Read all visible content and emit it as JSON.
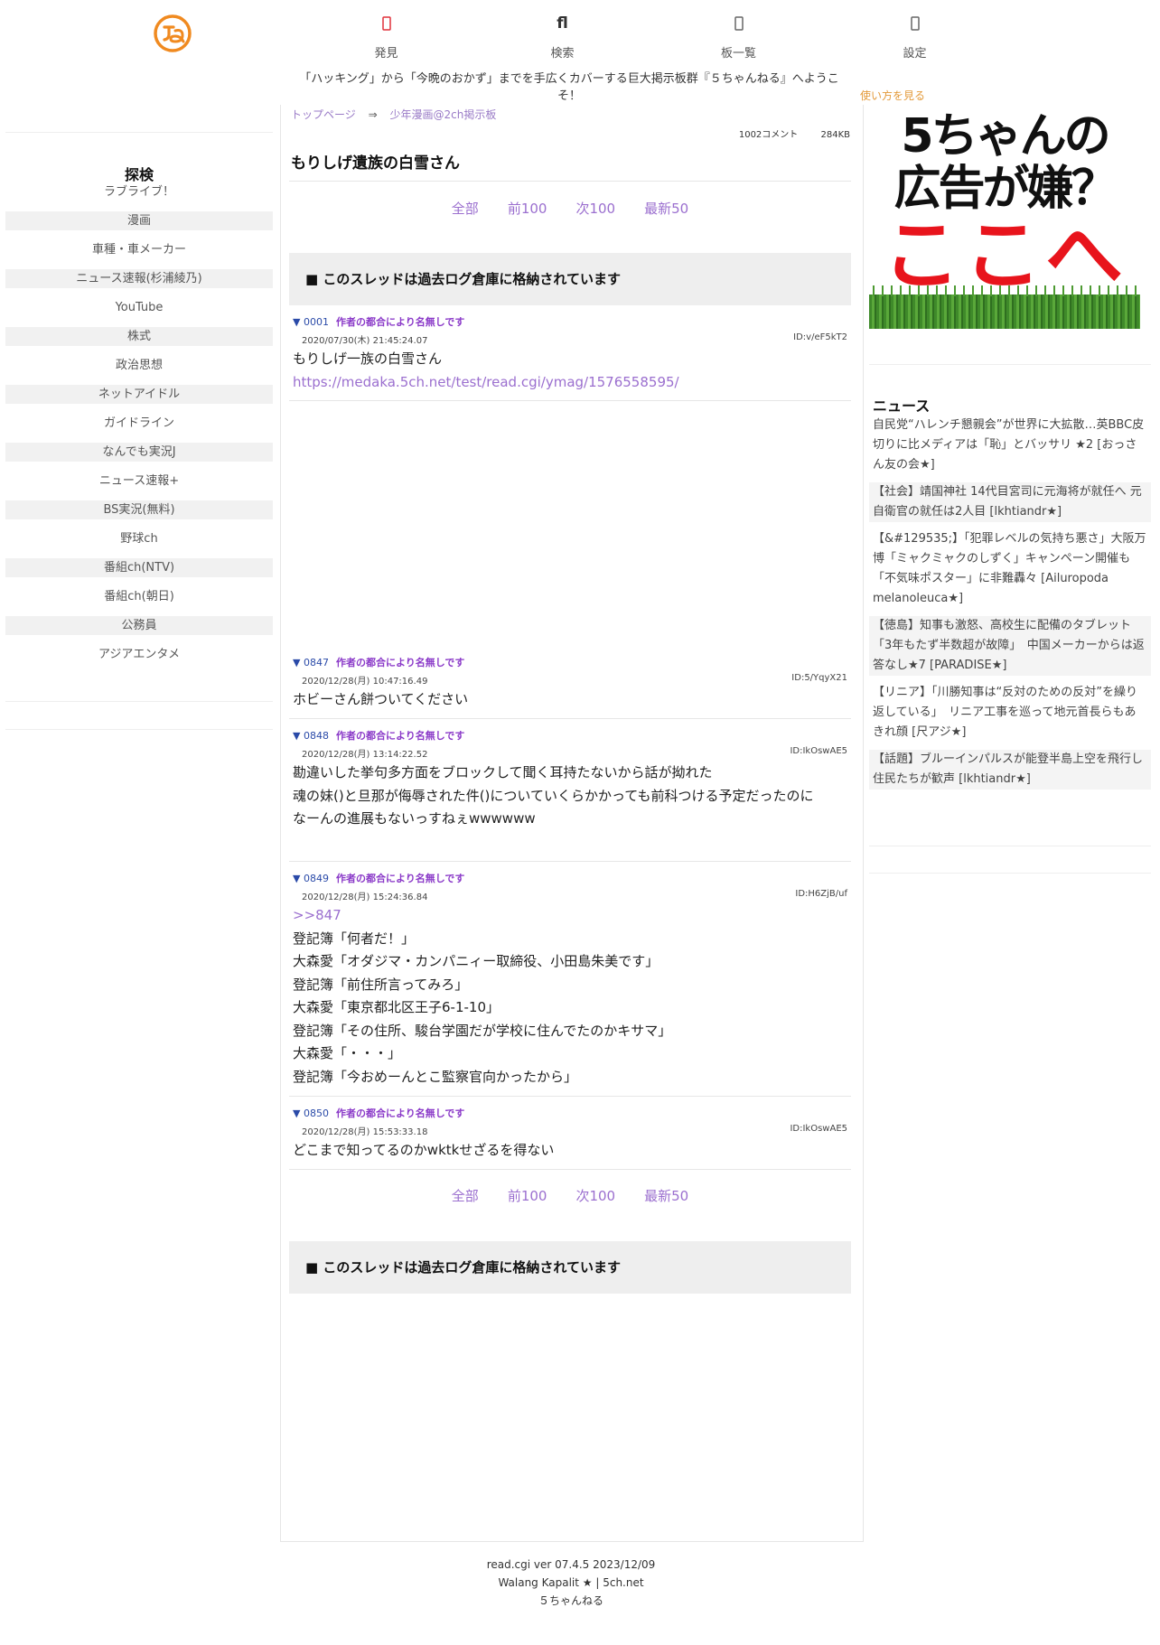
{
  "header": {
    "nav": [
      {
        "label": "発見",
        "icon": "discover-icon"
      },
      {
        "label": "検索",
        "icon": "search-icon"
      },
      {
        "label": "板一覧",
        "icon": "board-list-icon"
      },
      {
        "label": "設定",
        "icon": "settings-icon"
      }
    ],
    "tagline": "「ハッキング」から「今晩のおかず」までを手広くカバーする巨大掲示板群『５ちゃんねる』へようこそ！"
  },
  "sidebar": {
    "title": "探検",
    "items": [
      "ラブライブ！",
      "漫画",
      "車種・車メーカー",
      "ニュース速報(杉浦綾乃)",
      "YouTube",
      "株式",
      "政治思想",
      "ネットアイドル",
      "ガイドライン",
      "なんでも実況J",
      "ニュース速報+",
      "BS実況(無料)",
      "野球ch",
      "番組ch(NTV)",
      "番組ch(朝日)",
      "公務員",
      "アジアエンタメ"
    ]
  },
  "thread": {
    "breadcrumb_top": "トップページ",
    "breadcrumb_arrow": "⇒",
    "breadcrumb_board": "少年漫画@2ch掲示板",
    "comments": "1002コメント",
    "size": "284KB",
    "title": "もりしげ遺族の白雪さん",
    "pager": [
      "全部",
      "前100",
      "次100",
      "最新50"
    ],
    "archived": "■ このスレッドは過去ログ倉庫に格納されています"
  },
  "posts": [
    {
      "num": "0001",
      "name": "作者の都合により名無しです",
      "date": "2020/07/30(木) 21:45:24.07",
      "id": "ID:v/eF5kT2",
      "anchor": "",
      "lines": [
        "もりしげ一族の白雪さん"
      ],
      "link": "https://medaka.5ch.net/test/read.cgi/ymag/1576558595/"
    },
    {
      "num": "0847",
      "name": "作者の都合により名無しです",
      "date": "2020/12/28(月) 10:47:16.49",
      "id": "ID:5/YqyX21",
      "anchor": "",
      "lines": [
        "ホビーさん餅ついてください"
      ],
      "link": ""
    },
    {
      "num": "0848",
      "name": "作者の都合により名無しです",
      "date": "2020/12/28(月) 13:14:22.52",
      "id": "ID:IkOswAE5",
      "anchor": "",
      "lines": [
        "勘違いした挙句多方面をブロックして聞く耳持たないから話が拗れた",
        "魂の妹()と旦那が侮辱された件()についていくらかかっても前科つける予定だったのに",
        "なーんの進展もないっすねぇwwwwww"
      ],
      "link": ""
    },
    {
      "num": "0849",
      "name": "作者の都合により名無しです",
      "date": "2020/12/28(月) 15:24:36.84",
      "id": "ID:H6ZjB/uf",
      "anchor": ">>847",
      "lines": [
        "登記簿「何者だ！」",
        "大森愛「オダジマ・カンパニィー取締役、小田島朱美です」",
        "登記簿「前住所言ってみろ」",
        "大森愛「東京都北区王子6-1-10」",
        "登記簿「その住所、駿台学園だが学校に住んでたのかキサマ」",
        "大森愛「・・・」",
        "登記簿「今おめーんとこ監察官向かったから」"
      ],
      "link": ""
    },
    {
      "num": "0850",
      "name": "作者の都合により名無しです",
      "date": "2020/12/28(月) 15:53:33.18",
      "id": "ID:IkOswAE5",
      "anchor": "",
      "lines": [
        "どこまで知ってるのかwktkせざるを得ない"
      ],
      "link": ""
    }
  ],
  "right": {
    "howto": "使い方を見る",
    "ad": {
      "line1": "5ちゃんの",
      "line2": "広告が嫌？",
      "line3": "ここへ"
    },
    "news_title": "ニュース",
    "news": [
      "自民党“ハレンチ懇親会”が世界に大拡散…英BBC皮切りに比メディアは「恥」とバッサリ ★2 [おっさん友の会★]",
      "【社会】靖国神社 14代目宮司に元海将が就任へ 元自衛官の就任は2人目 [lkhtiandr★]",
      "【&#129535;】「犯罪レベルの気持ち悪さ」大阪万博「ミャクミャクのしずく」キャンペーン開催も「不気味ポスター」に非難轟々 [Ailuropoda melanoleuca★]",
      "【徳島】知事も激怒、高校生に配備のタブレット「3年もたず半数超が故障」　中国メーカーからは返答なし★7 [PARADISE★]",
      "【リニア】「川勝知事は“反対のための反対”を繰り返している」　リニア工事を巡って地元首長らもあきれ顔 [尺アジ★]",
      "【話題】ブルーインパルスが能登半島上空を飛行し 住民たちが歓声 [lkhtiandr★]"
    ]
  },
  "footer": {
    "version": "read.cgi ver 07.4.5 2023/12/09",
    "credit": "Walang Kapalit ★ | 5ch.net",
    "site": "５ちゃんねる"
  }
}
